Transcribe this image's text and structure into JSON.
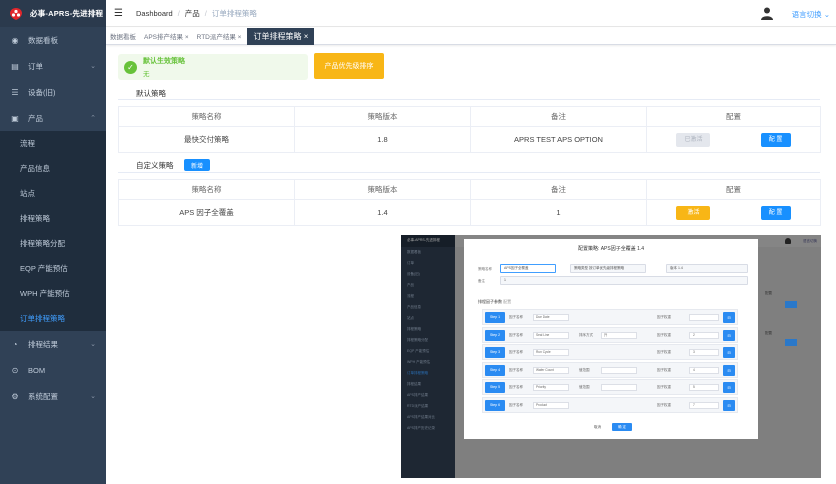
{
  "app": {
    "title": "必事-APRS-先进排程"
  },
  "sidebar": {
    "items": [
      {
        "label": "数据看板",
        "icon": "dashboard-icon"
      },
      {
        "label": "订单",
        "icon": "cart-icon"
      },
      {
        "label": "设备(旧)",
        "icon": "list-icon"
      },
      {
        "label": "产品",
        "icon": "box-icon"
      }
    ],
    "product_sub": [
      {
        "label": "流程"
      },
      {
        "label": "产品信息"
      },
      {
        "label": "站点"
      },
      {
        "label": "排程策略"
      },
      {
        "label": "排程策略分配"
      },
      {
        "label": "EQP 产能预估"
      },
      {
        "label": "WPH 产能预估"
      },
      {
        "label": "订单排程策略"
      }
    ],
    "bottom_items": [
      {
        "label": "排程结果",
        "icon": "clock-icon"
      },
      {
        "label": "BOM",
        "icon": "bom-icon"
      },
      {
        "label": "系统配置",
        "icon": "settings-icon"
      }
    ]
  },
  "navbar": {
    "breadcrumb": [
      "Dashboard",
      "产品",
      "订单排程策略"
    ],
    "separator": "/",
    "language": "语言切换"
  },
  "tags": [
    {
      "label": "数据看板"
    },
    {
      "label": "APS排产结果"
    },
    {
      "label": "RTD派产结果"
    },
    {
      "label": "订单排程策略",
      "close": "×"
    }
  ],
  "notice": {
    "title": "默认生效策略",
    "subtitle": "无"
  },
  "priority_button": "产品优先级排序",
  "default_section": {
    "label": "默认策略",
    "headers": [
      "策略名称",
      "策略版本",
      "备注",
      "配置"
    ],
    "row": {
      "name": "最快交付策略",
      "version": "1.8",
      "remark": "APRS TEST APS OPTION",
      "btn_disabled": "已激活",
      "btn_config": "配 置"
    }
  },
  "custom_section": {
    "label": "自定义策略",
    "new_button": "新增",
    "headers": [
      "策略名称",
      "策略版本",
      "备注",
      "配置"
    ],
    "row": {
      "name": "APS 因子全覆盖",
      "version": "1.4",
      "remark": "1",
      "btn_activate": "激活",
      "btn_config": "配 置"
    }
  },
  "inset": {
    "logo": "必事-APRS-先进排程",
    "lang": "语言切换",
    "right_label": "配置",
    "side_items": [
      "数据看板",
      "订单",
      "设备(旧)",
      "产品",
      "流程",
      "产品信息",
      "站点",
      "排程策略",
      "排程策略分配",
      "EQP 产能预估",
      "WPH 产能预估",
      "订单排程策略",
      "排程结果",
      "APS排产结果",
      "RTD派产结果",
      "APS排产结果对比",
      "APS排产历史记录"
    ],
    "dialog": {
      "title": "配置策略: APS因子全覆盖 1.4",
      "name_label": "策略名称",
      "name_value": "APS因子全覆盖",
      "remark_label": "备注",
      "remark_value": "1",
      "version_label": "版本",
      "version_value": "1.4",
      "type_label": "策略类型",
      "type_value": "按订单优先级排程策略",
      "sub_label": "排程因子参数",
      "sub_hint": "配置",
      "rows": [
        {
          "step": "Step 1",
          "l1": "因子名称",
          "s1": "Due Date",
          "l2": "",
          "s2": "",
          "l3": "因子权重",
          "n": "",
          "act": "⊟"
        },
        {
          "step": "Step 2",
          "l1": "因子名称",
          "s1": "Seal Line",
          "l2": "排序方式",
          "s2": "升",
          "l3": "因子权重",
          "n": "2",
          "act": "⊟"
        },
        {
          "step": "Step 3",
          "l1": "因子名称",
          "s1": "Run Cycle",
          "l2": "",
          "s2": "",
          "l3": "因子权重",
          "n": "3",
          "act": "⊟"
        },
        {
          "step": "Step 4",
          "l1": "因子名称",
          "s1": "Wafer Count",
          "l2": "值范围",
          "s2": "",
          "l3": "因子权重",
          "n": "4",
          "act": "⊟"
        },
        {
          "step": "Step 5",
          "l1": "因子名称",
          "s1": "Priority",
          "l2": "值范围",
          "s2": "",
          "l3": "因子权重",
          "n": "5",
          "act": "⊟"
        },
        {
          "step": "Step 6",
          "l1": "因子名称",
          "s1": "Product",
          "l2": "",
          "s2": "",
          "l3": "因子权重",
          "n": "7",
          "act": "⊟"
        }
      ],
      "cancel": "取消",
      "ok": "确 定"
    }
  },
  "colors": {
    "sidebar": "#304156",
    "accent": "#409eff",
    "success": "#67c23a",
    "warning": "#f8b616"
  }
}
